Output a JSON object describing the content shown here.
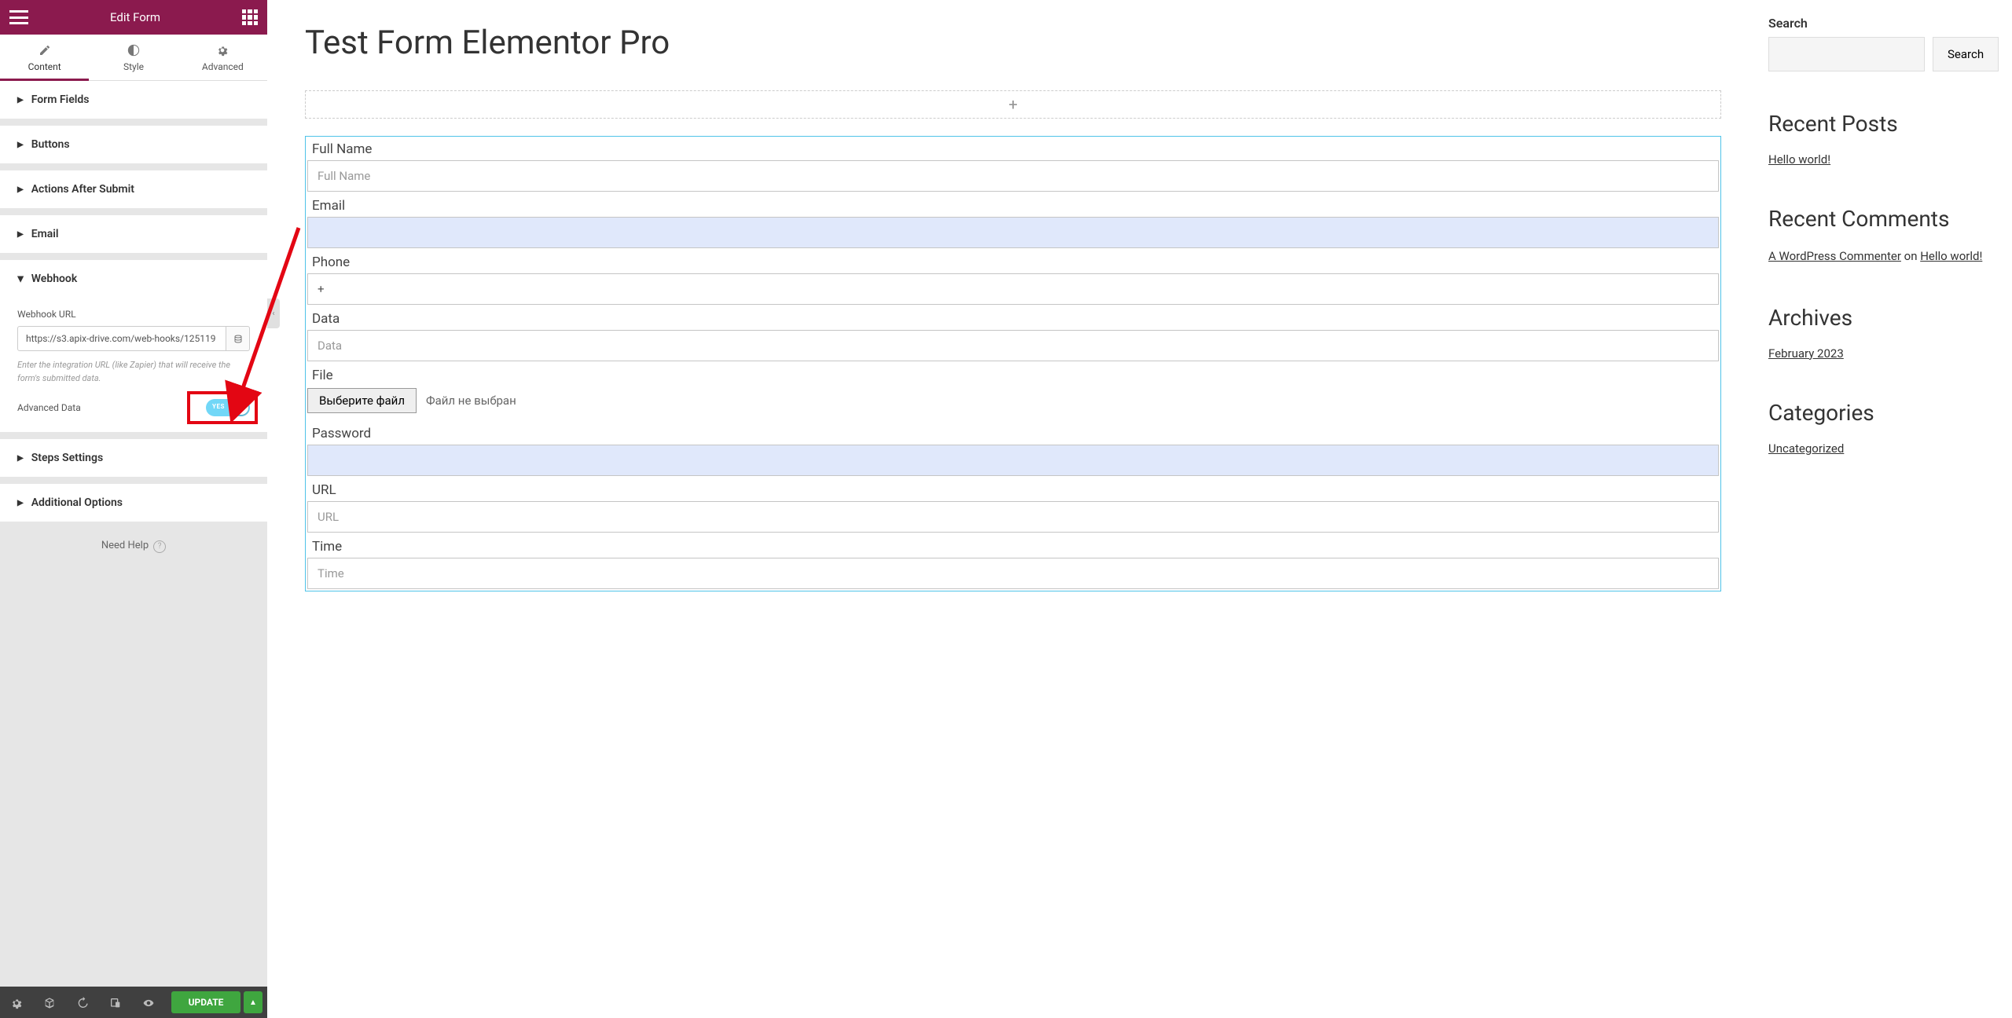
{
  "sidebar": {
    "title": "Edit Form",
    "tabs": {
      "content": "Content",
      "style": "Style",
      "advanced": "Advanced"
    },
    "sections": {
      "form_fields": "Form Fields",
      "buttons": "Buttons",
      "actions_after_submit": "Actions After Submit",
      "email": "Email",
      "webhook": "Webhook",
      "steps_settings": "Steps Settings",
      "additional_options": "Additional Options"
    },
    "webhook": {
      "label": "Webhook URL",
      "value": "https://s3.apix-drive.com/web-hooks/125119",
      "helper": "Enter the integration URL (like Zapier) that will receive the form's submitted data.",
      "advanced_label": "Advanced Data",
      "toggle_on_text": "YES"
    },
    "need_help": "Need Help",
    "footer": {
      "update": "UPDATE"
    }
  },
  "page": {
    "title": "Test Form Elementor Pro",
    "form": {
      "fields": [
        {
          "label": "Full Name",
          "placeholder": "Full Name",
          "type": "text"
        },
        {
          "label": "Email",
          "placeholder": "",
          "type": "email",
          "highlight": true
        },
        {
          "label": "Phone",
          "placeholder": "",
          "value": "+",
          "type": "text"
        },
        {
          "label": "Data",
          "placeholder": "Data",
          "type": "text"
        },
        {
          "label": "File",
          "type": "file",
          "button": "Выберите файл",
          "status": "Файл не выбран"
        },
        {
          "label": "Password",
          "placeholder": "",
          "type": "password",
          "highlight": true
        },
        {
          "label": "URL",
          "placeholder": "URL",
          "type": "text"
        },
        {
          "label": "Time",
          "placeholder": "Time",
          "type": "text"
        }
      ]
    }
  },
  "rsidebar": {
    "search_label": "Search",
    "search_button": "Search",
    "recent_posts": {
      "title": "Recent Posts",
      "items": [
        "Hello world!"
      ]
    },
    "recent_comments": {
      "title": "Recent Comments",
      "commenter": "A WordPress Commenter",
      "on": " on ",
      "post": "Hello world!"
    },
    "archives": {
      "title": "Archives",
      "items": [
        "February 2023"
      ]
    },
    "categories": {
      "title": "Categories",
      "items": [
        "Uncategorized"
      ]
    }
  }
}
